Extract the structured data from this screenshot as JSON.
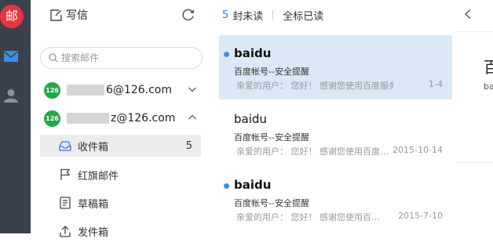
{
  "app": {
    "logo_text": "邮"
  },
  "rail": {
    "items": [
      {
        "icon": "mail-icon"
      },
      {
        "icon": "contacts-icon"
      }
    ]
  },
  "toolbar": {
    "compose_label": "写信"
  },
  "search": {
    "placeholder": "搜索邮件"
  },
  "accounts": [
    {
      "badge": "126",
      "address_suffix": "6@126.com",
      "expanded": false
    },
    {
      "badge": "126",
      "address_suffix": "z@126.com",
      "expanded": true
    }
  ],
  "folders": [
    {
      "name": "收件箱",
      "count": "5",
      "active": true,
      "icon": "inbox-icon"
    },
    {
      "name": "红旗邮件",
      "count": "",
      "active": false,
      "icon": "flag-icon"
    },
    {
      "name": "草稿箱",
      "count": "",
      "active": false,
      "icon": "draft-icon"
    },
    {
      "name": "发件箱",
      "count": "",
      "active": false,
      "icon": "outbox-icon"
    }
  ],
  "list_header": {
    "unread_count": "5",
    "unread_label": "封未读",
    "mark_all_label": "全标已读"
  },
  "messages": [
    {
      "sender": "baidu",
      "subject": "百度帐号--安全提醒",
      "preview": "亲爱的用户： 您好！ 感谢您使用百度服务…",
      "date": "1-4",
      "unread": true,
      "selected": true
    },
    {
      "sender": "baidu",
      "subject": "百度帐号--安全提醒",
      "preview": "亲爱的用户： 您好！ 感谢您使用百度…",
      "date": "2015-10-14",
      "unread": false,
      "selected": false
    },
    {
      "sender": "baidu",
      "subject": "百度帐号--安全提醒",
      "preview": "亲爱的用户： 您好！ 感谢您使用百…",
      "date": "2015-7-10",
      "unread": true,
      "selected": false
    }
  ],
  "reader": {
    "title": "百",
    "from": "ba"
  },
  "colors": {
    "accent": "#3479e6",
    "rail": "#3a414c",
    "logo": "#e8343f",
    "badge": "#27a645",
    "selected": "#dbe8f7",
    "unread_dot": "#3d8eea"
  }
}
